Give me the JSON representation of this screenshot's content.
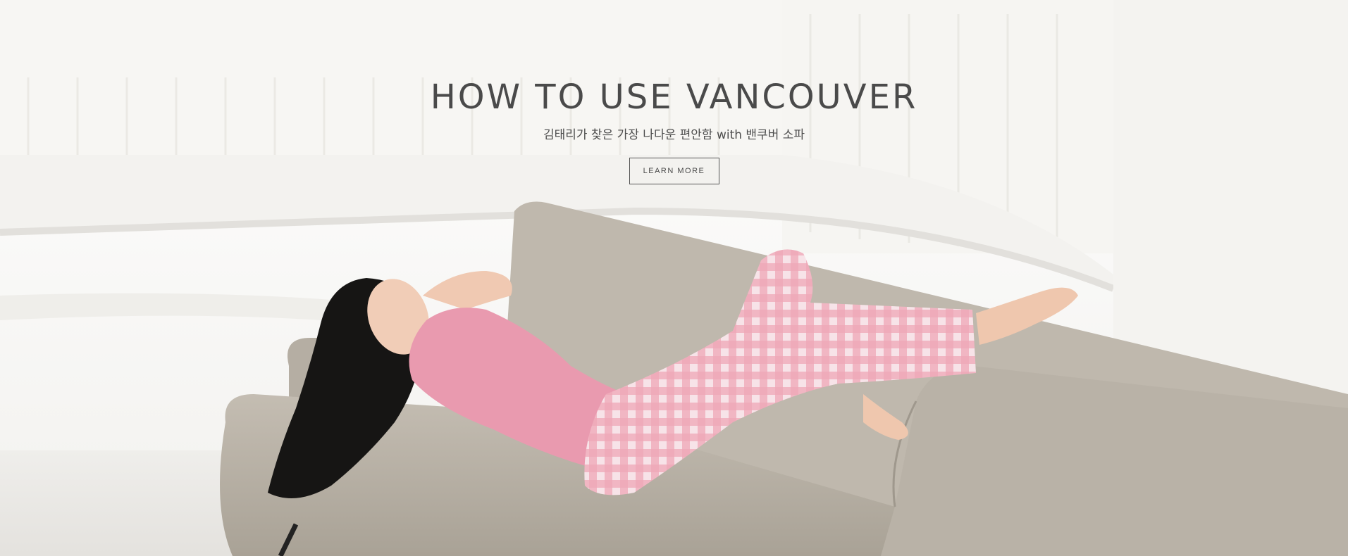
{
  "hero": {
    "title": "HOW TO USE VANCOUVER",
    "subtitle": "김태리가 찾은 가장 나다운 편안함 with 밴쿠버 소파",
    "cta_label": "LEARN MORE"
  },
  "colors": {
    "text": "#4a4a4a",
    "sofa": "#b8b1a6",
    "top": "#e99aaf",
    "pants": "#eaa4b4",
    "background": "#f4f3f1"
  }
}
